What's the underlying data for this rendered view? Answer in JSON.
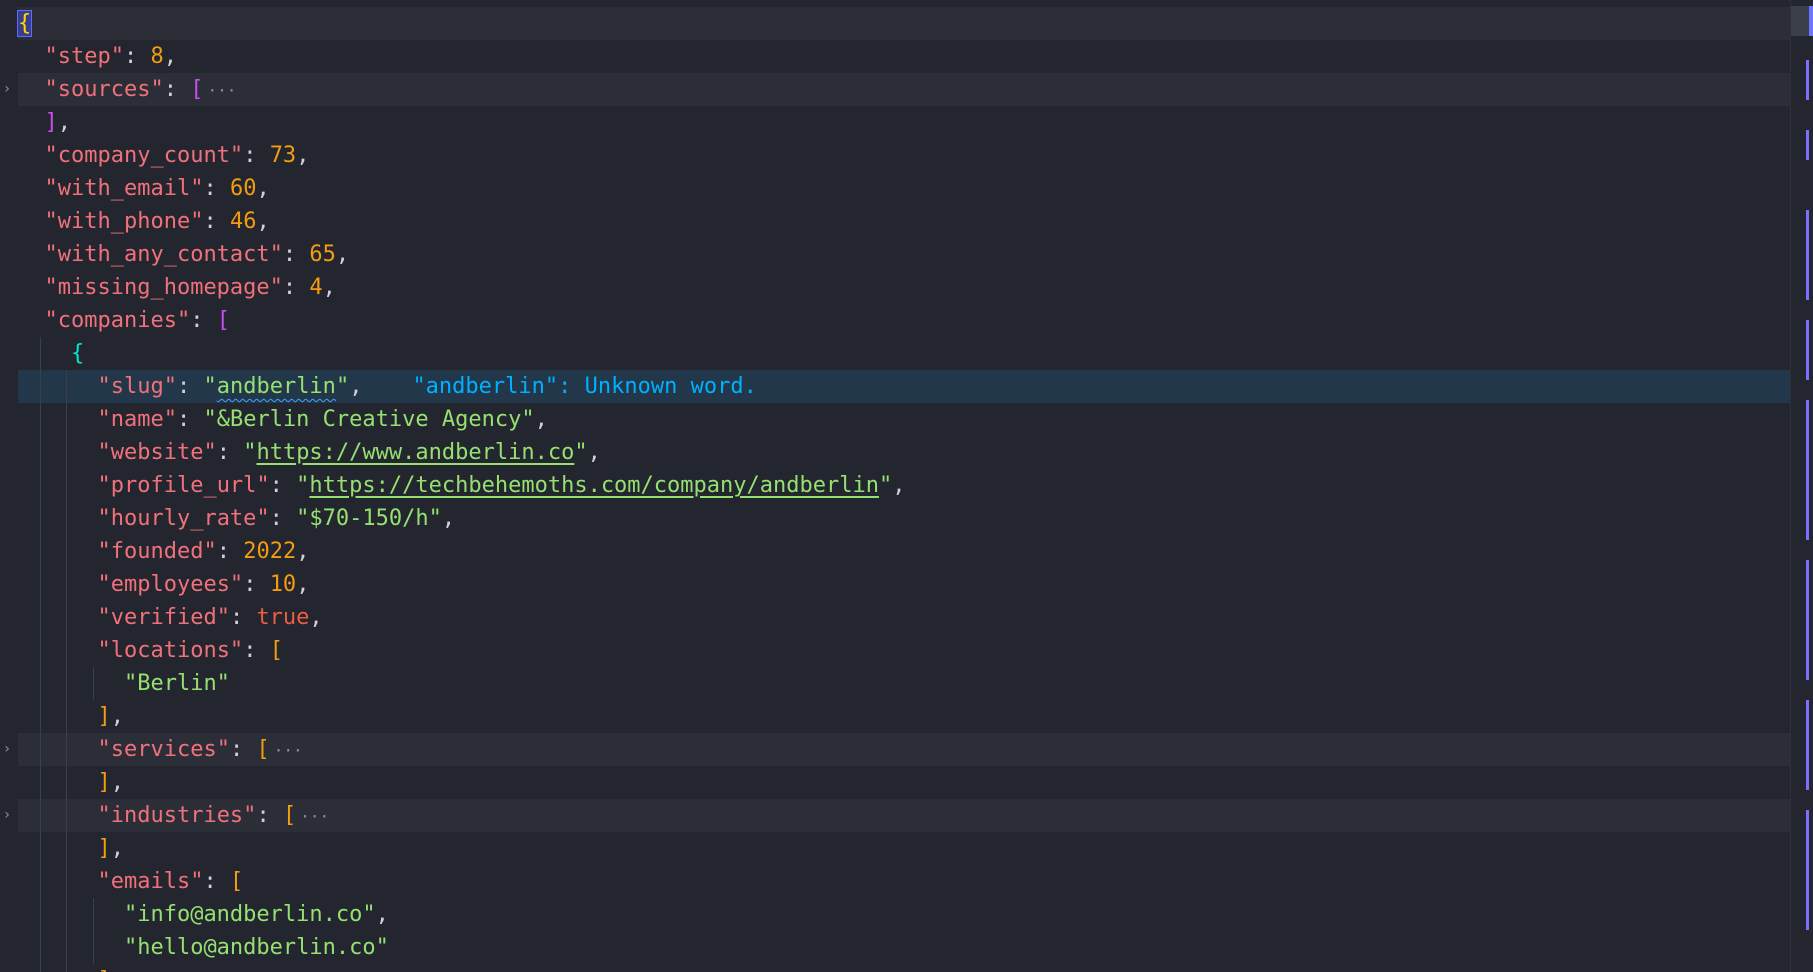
{
  "hint": {
    "word": "\"andberlin\"",
    "message": ": Unknown word."
  },
  "json": {
    "step_key": "\"step\"",
    "step_val": "8",
    "sources_key": "\"sources\"",
    "company_count_key": "\"company_count\"",
    "company_count_val": "73",
    "with_email_key": "\"with_email\"",
    "with_email_val": "60",
    "with_phone_key": "\"with_phone\"",
    "with_phone_val": "46",
    "with_any_contact_key": "\"with_any_contact\"",
    "with_any_contact_val": "65",
    "missing_homepage_key": "\"missing_homepage\"",
    "missing_homepage_val": "4",
    "companies_key": "\"companies\"",
    "slug_key": "\"slug\"",
    "slug_val": "andberlin",
    "name_key": "\"name\"",
    "name_val": "\"&Berlin Creative Agency\"",
    "website_key": "\"website\"",
    "website_val": "https://www.andberlin.co",
    "profile_url_key": "\"profile_url\"",
    "profile_url_val": "https://techbehemoths.com/company/andberlin",
    "hourly_rate_key": "\"hourly_rate\"",
    "hourly_rate_val": "\"$70-150/h\"",
    "founded_key": "\"founded\"",
    "founded_val": "2022",
    "employees_key": "\"employees\"",
    "employees_val": "10",
    "verified_key": "\"verified\"",
    "verified_val": "true",
    "locations_key": "\"locations\"",
    "location_0": "\"Berlin\"",
    "services_key": "\"services\"",
    "industries_key": "\"industries\"",
    "emails_key": "\"emails\"",
    "email_0": "\"info@andberlin.co\"",
    "email_1": "\"hello@andberlin.co\""
  },
  "glyphs": {
    "ellipsis": "···",
    "fold": "›"
  }
}
